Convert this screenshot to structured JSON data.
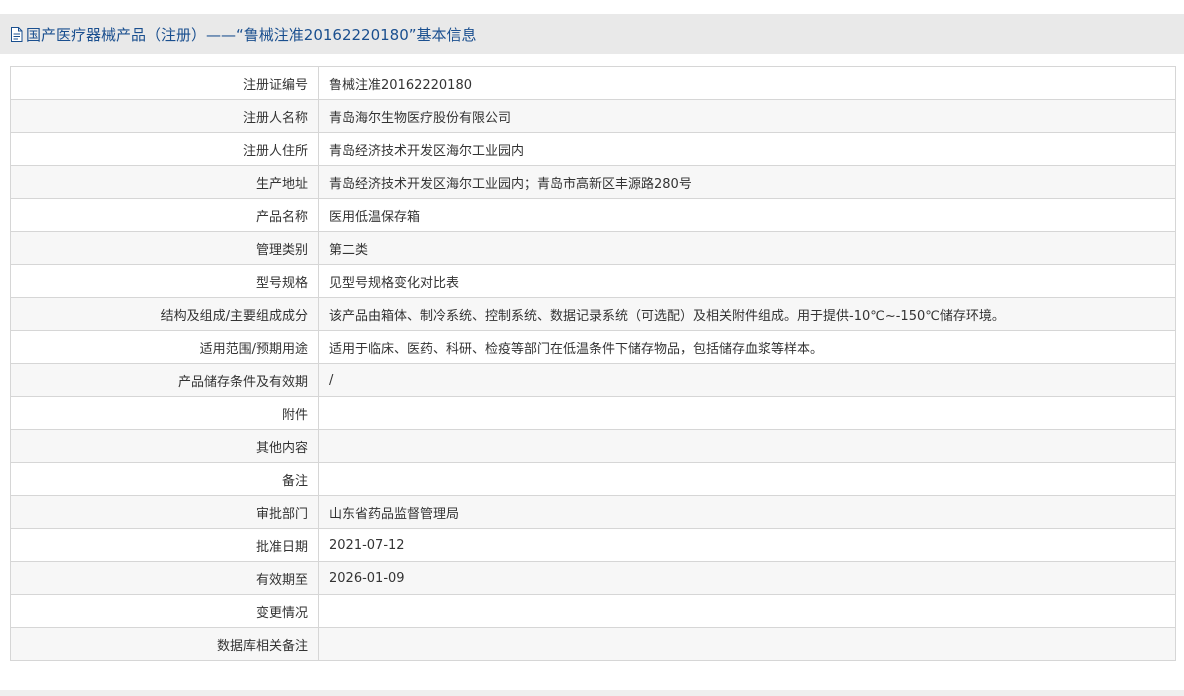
{
  "header": {
    "icon": "document-icon",
    "title": "国产医疗器械产品（注册）——“鲁械注准20162220180”基本信息"
  },
  "rows": [
    {
      "label": "注册证编号",
      "value": "鲁械注准20162220180"
    },
    {
      "label": "注册人名称",
      "value": "青岛海尔生物医疗股份有限公司"
    },
    {
      "label": "注册人住所",
      "value": "青岛经济技术开发区海尔工业园内"
    },
    {
      "label": "生产地址",
      "value": "青岛经济技术开发区海尔工业园内；青岛市高新区丰源路280号"
    },
    {
      "label": "产品名称",
      "value": "医用低温保存箱"
    },
    {
      "label": "管理类别",
      "value": "第二类"
    },
    {
      "label": "型号规格",
      "value": "见型号规格变化对比表"
    },
    {
      "label": "结构及组成/主要组成成分",
      "value": "该产品由箱体、制冷系统、控制系统、数据记录系统（可选配）及相关附件组成。用于提供-10℃~-150℃储存环境。"
    },
    {
      "label": "适用范围/预期用途",
      "value": "适用于临床、医药、科研、检疫等部门在低温条件下储存物品，包括储存血浆等样本。"
    },
    {
      "label": "产品储存条件及有效期",
      "value": "/"
    },
    {
      "label": "附件",
      "value": ""
    },
    {
      "label": "其他内容",
      "value": ""
    },
    {
      "label": "备注",
      "value": ""
    },
    {
      "label": "审批部门",
      "value": "山东省药品监督管理局"
    },
    {
      "label": "批准日期",
      "value": "2021-07-12"
    },
    {
      "label": "有效期至",
      "value": "2026-01-09"
    },
    {
      "label": "变更情况",
      "value": ""
    },
    {
      "label": "数据库相关备注",
      "value": ""
    }
  ]
}
